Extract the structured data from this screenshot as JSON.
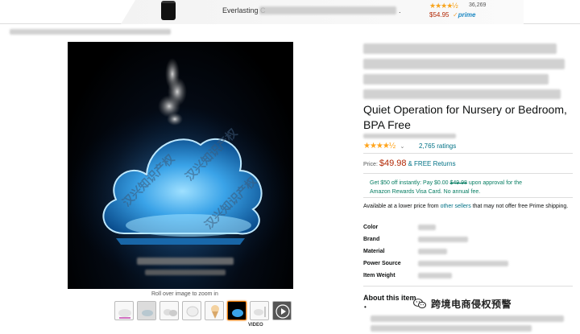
{
  "sponsored_strip": {
    "title_partial": "Everlasting C",
    "title_end": ".",
    "stars": "★★★★½",
    "review_count": "36,269",
    "price": "$54.95",
    "prime": "prime",
    "prime_check": "✓"
  },
  "gallery": {
    "roll_over_text": "Roll over image to zoom in",
    "video_label": "VIDEO",
    "watermark_text": "汉兴知识产权",
    "thumbnails": [
      {
        "name": "thumb-cloud-white"
      },
      {
        "name": "thumb-lifestyle"
      },
      {
        "name": "thumb-clouds"
      },
      {
        "name": "thumb-detail"
      },
      {
        "name": "thumb-ice-cream"
      },
      {
        "name": "thumb-blue-cloud",
        "selected": true
      },
      {
        "name": "thumb-dimensions"
      },
      {
        "name": "thumb-video"
      }
    ]
  },
  "product": {
    "title": "Quiet Operation for Nursery or Bedroom, BPA Free",
    "stars": "★★★★½",
    "rating_chevron": "⌄",
    "ratings_text": "2,765 ratings",
    "price_label": "Price:",
    "price": "$49.98",
    "free_returns": "& FREE Returns",
    "promo_line1": "Get $50 off instantly: Pay $0.00",
    "promo_struck": "$49.98",
    "promo_line1_end": "upon approval for the",
    "promo_line2": "Amazon Rewards Visa Card. No annual fee.",
    "lower_price_prefix": "Available at a lower price from",
    "lower_price_link": "other sellers",
    "lower_price_suffix": "that may not offer free Prime shipping.",
    "specs": [
      {
        "label": "Color"
      },
      {
        "label": "Brand"
      },
      {
        "label": "Material"
      },
      {
        "label": "Power Source"
      },
      {
        "label": "Item Weight"
      }
    ],
    "about_heading": "About this item",
    "bullet": "•"
  },
  "overlay": {
    "wechat_text": "跨境电商侵权预警"
  },
  "colors": {
    "price_red": "#b12704",
    "link_teal": "#007185",
    "promo_green": "#067d62",
    "star_orange": "#ffa41c",
    "cloud_blue": "#3aa3e8"
  }
}
